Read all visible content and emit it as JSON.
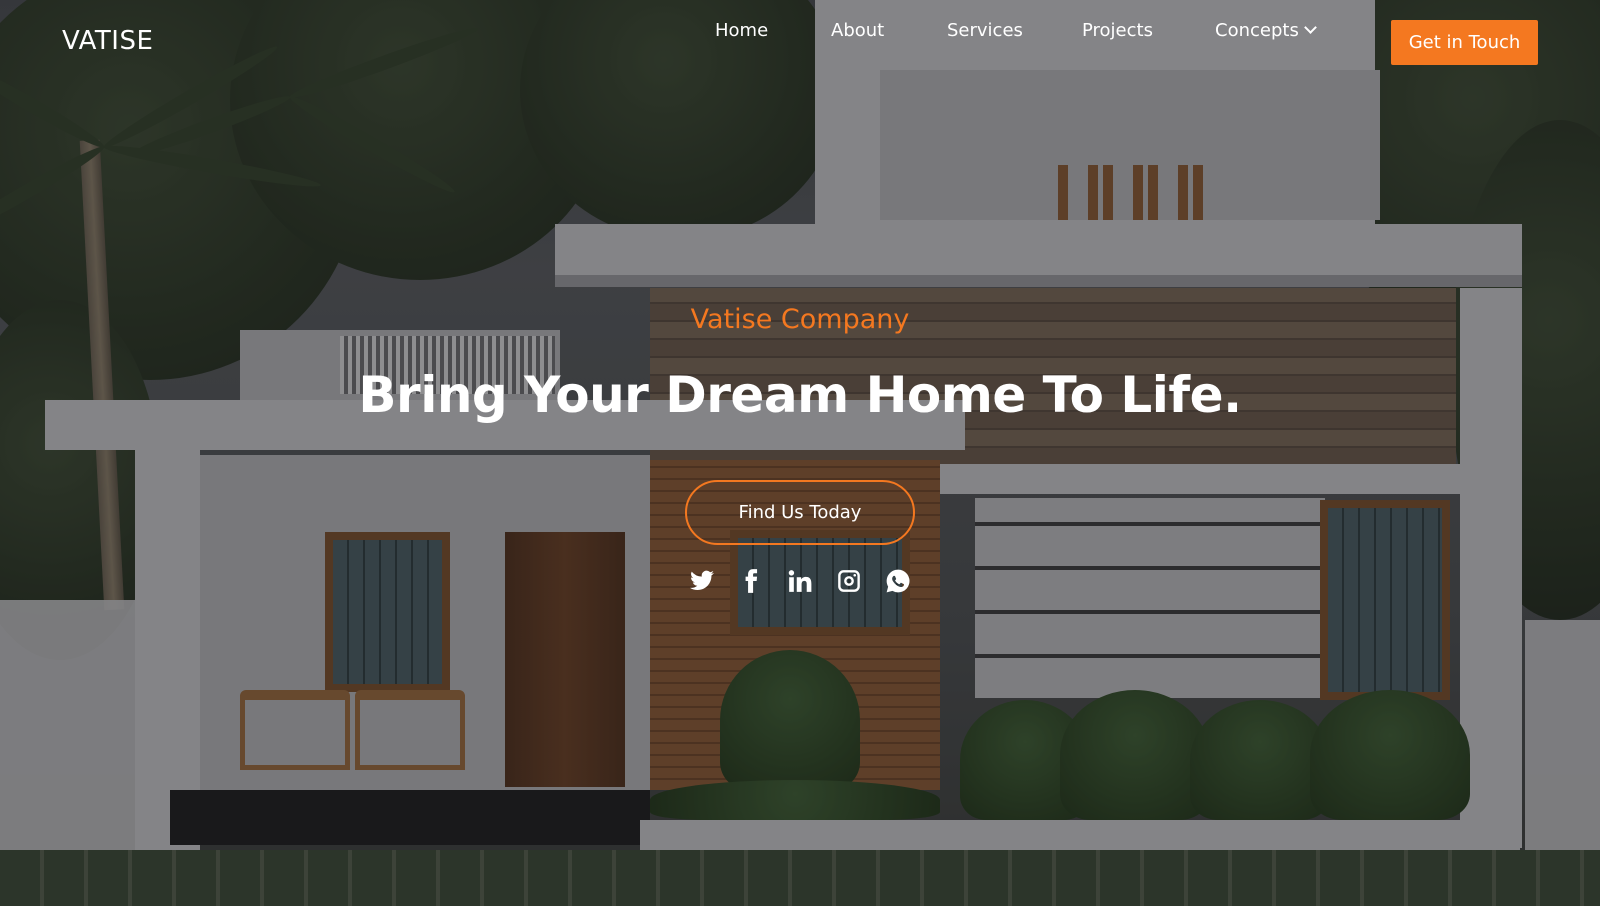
{
  "brand": {
    "logo": "VATISE",
    "accent_color": "#f47820"
  },
  "nav": {
    "items": [
      {
        "label": "Home"
      },
      {
        "label": "About"
      },
      {
        "label": "Services"
      },
      {
        "label": "Projects"
      },
      {
        "label": "Concepts",
        "has_dropdown": true,
        "icon": "chevron-down-icon"
      }
    ],
    "cta_label": "Get in Touch"
  },
  "hero": {
    "eyebrow": "Vatise Company",
    "headline": "Bring Your Dream Home To Life.",
    "button_label": "Find Us Today",
    "background": "modern single-storey house with palm trees"
  },
  "social": {
    "icons": [
      "twitter-icon",
      "facebook-icon",
      "linkedin-icon",
      "instagram-icon",
      "whatsapp-icon"
    ]
  }
}
